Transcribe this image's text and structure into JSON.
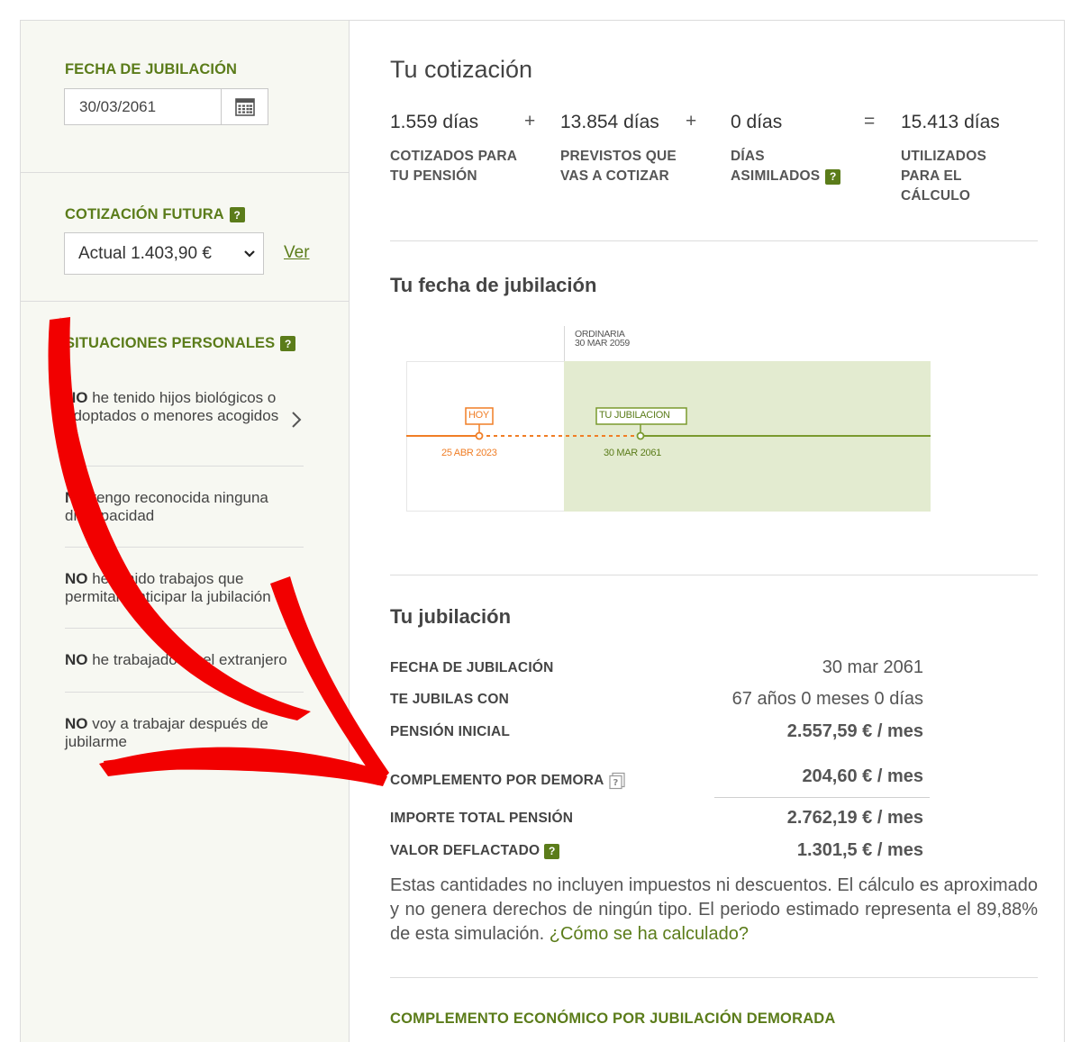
{
  "sidebar": {
    "retirement_date_label": "FECHA DE JUBILACIÓN",
    "retirement_date_value": "30/03/2061",
    "future_contribution_label": "COTIZACIÓN FUTURA",
    "future_contribution_selected": "Actual 1.403,90 €",
    "ver_link": "Ver",
    "personal_situations_label": "SITUACIONES PERSONALES",
    "situations": [
      {
        "strong": "NO",
        "text": " he tenido hijos biológicos o adoptados o menores acogidos"
      },
      {
        "strong": "NO",
        "text": " tengo reconocida ninguna discapacidad"
      },
      {
        "strong": "NO",
        "text": " he tenido trabajos que permitan anticipar la jubilación"
      },
      {
        "strong": "NO",
        "text": " he trabajado en el extranjero"
      },
      {
        "strong": "NO",
        "text": " voy a trabajar después de jubilarme"
      }
    ],
    "help_icon": "?"
  },
  "cotizacion": {
    "title": "Tu cotización",
    "items": [
      {
        "value": "1.559 días",
        "label_l1": "COTIZADOS PARA",
        "label_l2": "TU PENSIÓN"
      },
      {
        "value": "13.854 días",
        "label_l1": "PREVISTOS QUE",
        "label_l2": "VAS A COTIZAR"
      },
      {
        "value": "0 días",
        "label_l1": "DÍAS",
        "label_l2": "ASIMILADOS"
      },
      {
        "value": "15.413 días",
        "label_l1": "UTILIZADOS",
        "label_l2": "PARA EL",
        "label_l3": "CÁLCULO"
      }
    ],
    "ops": [
      "+",
      "+",
      "="
    ]
  },
  "timeline": {
    "title": "Tu fecha de jubilación",
    "ordinary_label": "ORDINARIA",
    "ordinary_date": "30 MAR 2059",
    "today_label": "HOY",
    "today_date": "25 ABR 2023",
    "retire_label": "TU JUBILACION",
    "retire_date": "30 MAR 2061",
    "colors": {
      "today": "#f07e26",
      "retire": "#7a9a2e",
      "green_bg": "#e3ebd0"
    }
  },
  "jubilacion": {
    "title": "Tu jubilación",
    "rows": [
      {
        "label": "FECHA DE JUBILACIÓN",
        "value": "30 mar 2061"
      },
      {
        "label": "TE JUBILAS CON",
        "value": "67 años 0 meses 0 días"
      },
      {
        "label": "PENSIÓN INICIAL",
        "value": "2.557,59 € / mes"
      },
      {
        "label": "COMPLEMENTO POR DEMORA",
        "value": "204,60 € / mes"
      },
      {
        "label": "IMPORTE TOTAL PENSIÓN",
        "value": "2.762,19 € / mes"
      },
      {
        "label": "VALOR DEFLACTADO",
        "value": "1.301,5 € / mes"
      }
    ],
    "note_text": "Estas cantidades no incluyen impuestos ni descuentos. El cálculo es aproximado y no genera derechos de ningún tipo. El periodo estimado representa el 89,88% de esta simulación. ",
    "note_link": "¿Cómo se ha calculado?"
  },
  "bottom_heading": "COMPLEMENTO ECONÓMICO POR JUBILACIÓN DEMORADA"
}
